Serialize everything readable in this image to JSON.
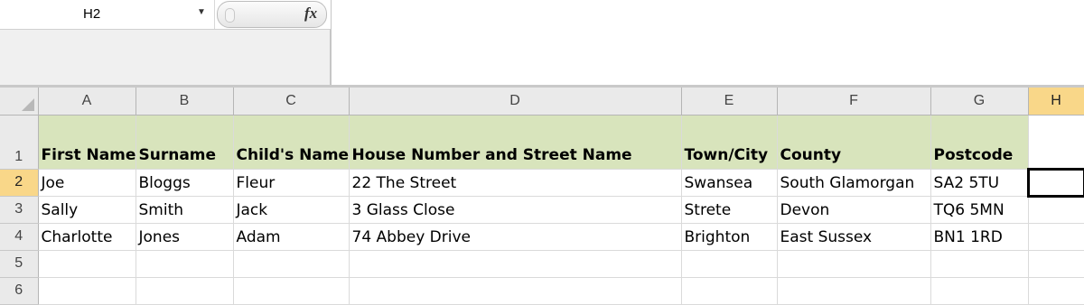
{
  "formula_bar": {
    "name_box": "H2",
    "fx_label": "fx",
    "formula_value": ""
  },
  "columns": [
    "A",
    "B",
    "C",
    "D",
    "E",
    "F",
    "G",
    "H"
  ],
  "rows": [
    {
      "num": "1",
      "cells": [
        "First Name",
        "Surname",
        "Child's Name",
        "House Number and Street Name",
        "Town/City",
        "County",
        "Postcode",
        ""
      ]
    },
    {
      "num": "2",
      "cells": [
        "Joe",
        "Bloggs",
        "Fleur",
        "22 The Street",
        "Swansea",
        "South Glamorgan",
        "SA2 5TU",
        ""
      ]
    },
    {
      "num": "3",
      "cells": [
        "Sally",
        "Smith",
        "Jack",
        "3 Glass Close",
        "Strete",
        "Devon",
        "TQ6 5MN",
        ""
      ]
    },
    {
      "num": "4",
      "cells": [
        "Charlotte",
        "Jones",
        "Adam",
        "74 Abbey Drive",
        "Brighton",
        "East Sussex",
        "BN1 1RD",
        ""
      ]
    },
    {
      "num": "5",
      "cells": [
        "",
        "",
        "",
        "",
        "",
        "",
        "",
        ""
      ]
    },
    {
      "num": "6",
      "cells": [
        "",
        "",
        "",
        "",
        "",
        "",
        "",
        ""
      ]
    }
  ],
  "selected_cell": "H2",
  "colors": {
    "header_fill": "#d8e4bc",
    "active_header": "#f9d789"
  }
}
